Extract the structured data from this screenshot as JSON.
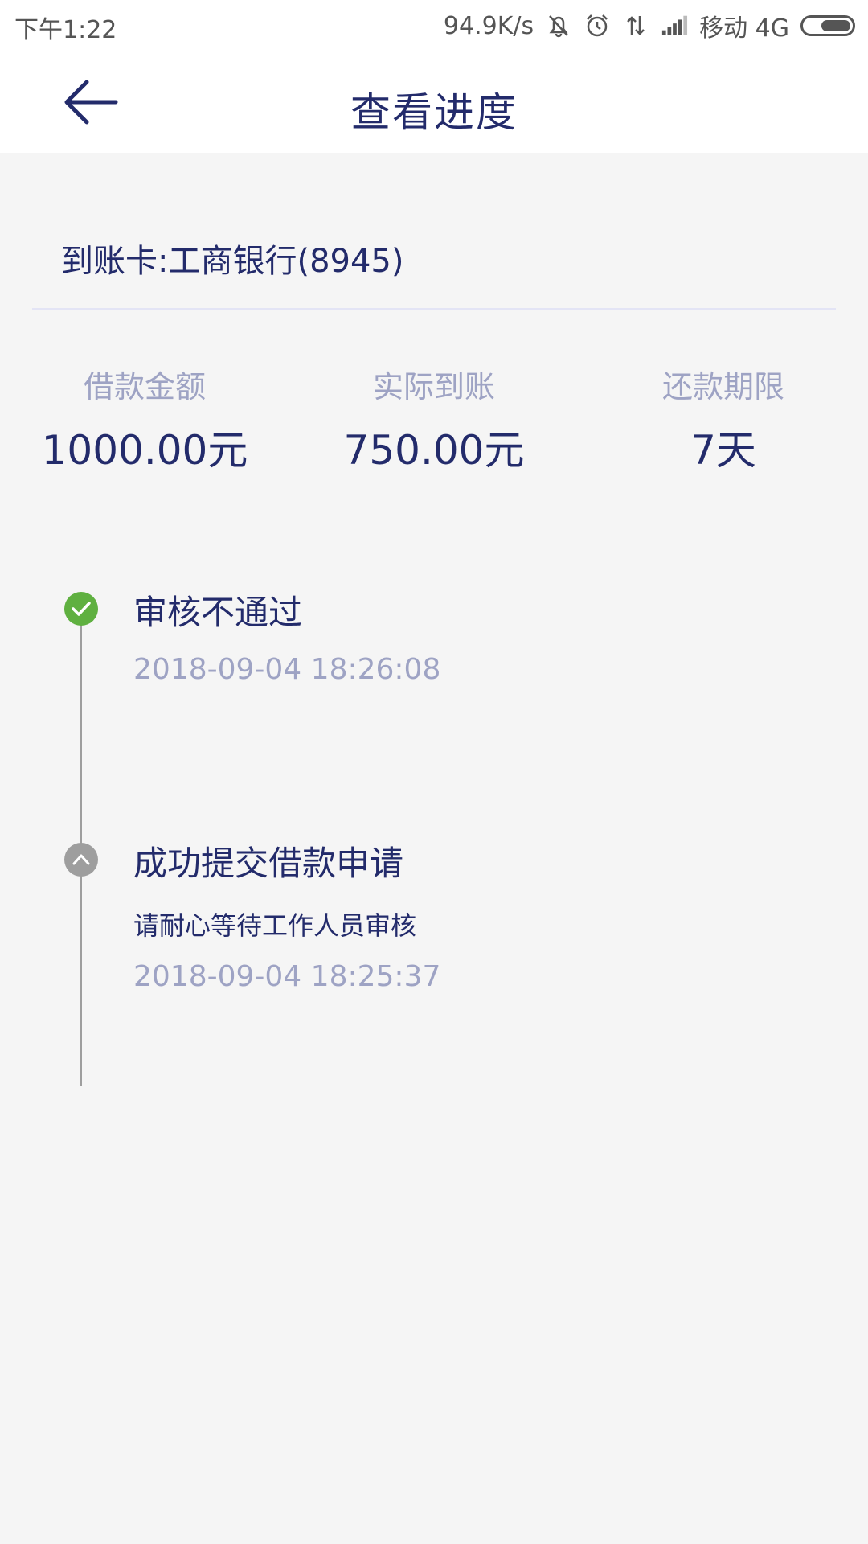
{
  "status_bar": {
    "time": "下午1:22",
    "network_speed": "94.9K/s",
    "carrier": "移动 4G",
    "icons": [
      "bell-muted-icon",
      "alarm-icon",
      "data-arrows-icon",
      "signal-icon",
      "battery-icon"
    ]
  },
  "header": {
    "back_icon": "back-arrow-icon",
    "title": "查看进度"
  },
  "card": {
    "text": "到账卡:工商银行(8945)"
  },
  "stats": [
    {
      "label": "借款金额",
      "value": "1000.00元"
    },
    {
      "label": "实际到账",
      "value": "750.00元"
    },
    {
      "label": "还款期限",
      "value": "7天"
    }
  ],
  "timeline": [
    {
      "title": "审核不通过",
      "time": "2018-09-04 18:26:08",
      "icon": "check-icon",
      "color": "#5fb040"
    },
    {
      "title": "成功提交借款申请",
      "subtitle": "请耐心等待工作人员审核",
      "time": "2018-09-04 18:25:37",
      "icon": "chevron-up-icon",
      "color": "#9e9e9e"
    }
  ],
  "colors": {
    "primary_text": "#232b6b",
    "muted_text": "#9ea3c4",
    "success": "#5fb040",
    "inactive": "#9e9e9e",
    "background": "#f5f5f5"
  }
}
